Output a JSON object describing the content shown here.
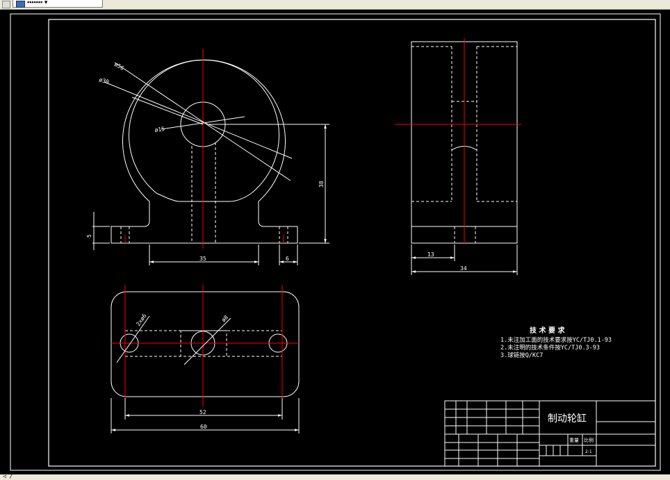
{
  "window": {
    "tab_label": "▪▪▪▪▪▪▪ ▾",
    "status_text": "◁ /"
  },
  "views": {
    "front": {
      "dims": {
        "d_outer": "ø56",
        "d_mid": "ø30",
        "d_hole": "ø15",
        "height": "38",
        "base_thk": "5",
        "width": "35",
        "lug": "6"
      }
    },
    "side": {
      "dims": {
        "offset": "13",
        "width": "34"
      }
    },
    "top": {
      "dims": {
        "holes": "2xø6",
        "center_hole": "ø8",
        "pitch": "52",
        "width": "60"
      }
    }
  },
  "notes": {
    "heading": "技 术 要 求",
    "lines": [
      "1.未注加工面的技术要求按YC/TJ0.1-93",
      "2.未注明的技术条件按YC/TJ0.3-93",
      "3.球链按Q/KC7"
    ]
  },
  "title_block": {
    "part_name": "制动轮缸",
    "labels": [
      "重量",
      "比例"
    ],
    "scale": "2:1"
  },
  "colors": {
    "outline": "#ffffff",
    "centerline": "#ff0000",
    "background": "#000000"
  }
}
